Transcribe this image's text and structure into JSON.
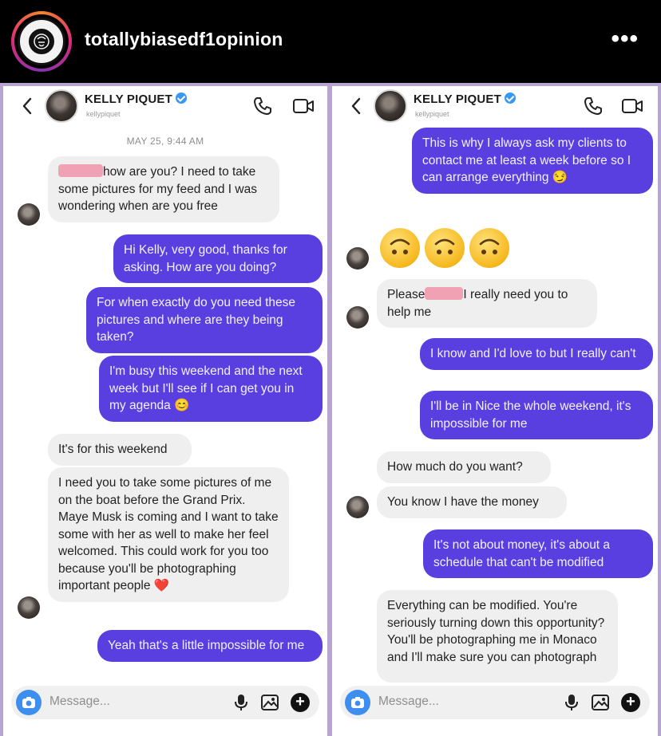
{
  "post": {
    "username": "totallybiasedf1opinion",
    "more_label": "•••",
    "avatar_text": "ZERO FUCKS GIVEN"
  },
  "chat": {
    "contact_name": "KELLY PIQUET",
    "contact_handle": "kellypiquet",
    "composer_placeholder": "Message..."
  },
  "left": {
    "timestamp": "MAY 25, 9:44 AM",
    "messages": [
      {
        "direction": "in",
        "text": "how are you? I need to take some pictures for my feed and I was wondering when are you free"
      },
      {
        "direction": "out",
        "text": "Hi Kelly, very good, thanks for asking. How are you doing?"
      },
      {
        "direction": "out",
        "text": "For when exactly do you need these pictures and where are they being taken?"
      },
      {
        "direction": "out",
        "text": "I'm busy this weekend and the next week but I'll see if I can get you in my agenda 😊"
      },
      {
        "direction": "in",
        "text": "It's for this weekend"
      },
      {
        "direction": "in",
        "text": "I need you to take some pictures of me on the boat before the Grand Prix. Maye Musk is coming and I want to take some with her as well to make her feel welcomed. This could work for you too because you'll be photographing important people ❤️"
      },
      {
        "direction": "out",
        "text": "Yeah that's a little impossible for me"
      }
    ]
  },
  "right": {
    "messages": [
      {
        "direction": "out",
        "text": "This is why I always ask my clients to contact me at least a week before so I can arrange everything 😏"
      },
      {
        "direction": "in",
        "text": "🙃🙃🙃"
      },
      {
        "direction": "in",
        "text_before": "Please",
        "text_after": "I really need you to help me"
      },
      {
        "direction": "out",
        "text": "I know and I'd love to but I really can't"
      },
      {
        "direction": "out",
        "text": "I'll be in Nice the whole weekend, it's impossible for me"
      },
      {
        "direction": "in",
        "text": "How much do you want?"
      },
      {
        "direction": "in",
        "text": "You know I have the money"
      },
      {
        "direction": "out",
        "text": "It's not about money, it's about a schedule that can't be modified"
      },
      {
        "direction": "in",
        "text": "Everything can be modified. You're seriously turning down this opportunity? You'll be photographing me in Monaco and I'll make sure you can photograph"
      }
    ]
  },
  "colors": {
    "outgoing_bubble": "#5a3fe0",
    "incoming_bubble": "#efefef",
    "panel_border": "#b7a4d2",
    "verified": "#3897f0",
    "redaction": "#f0a1b4"
  }
}
